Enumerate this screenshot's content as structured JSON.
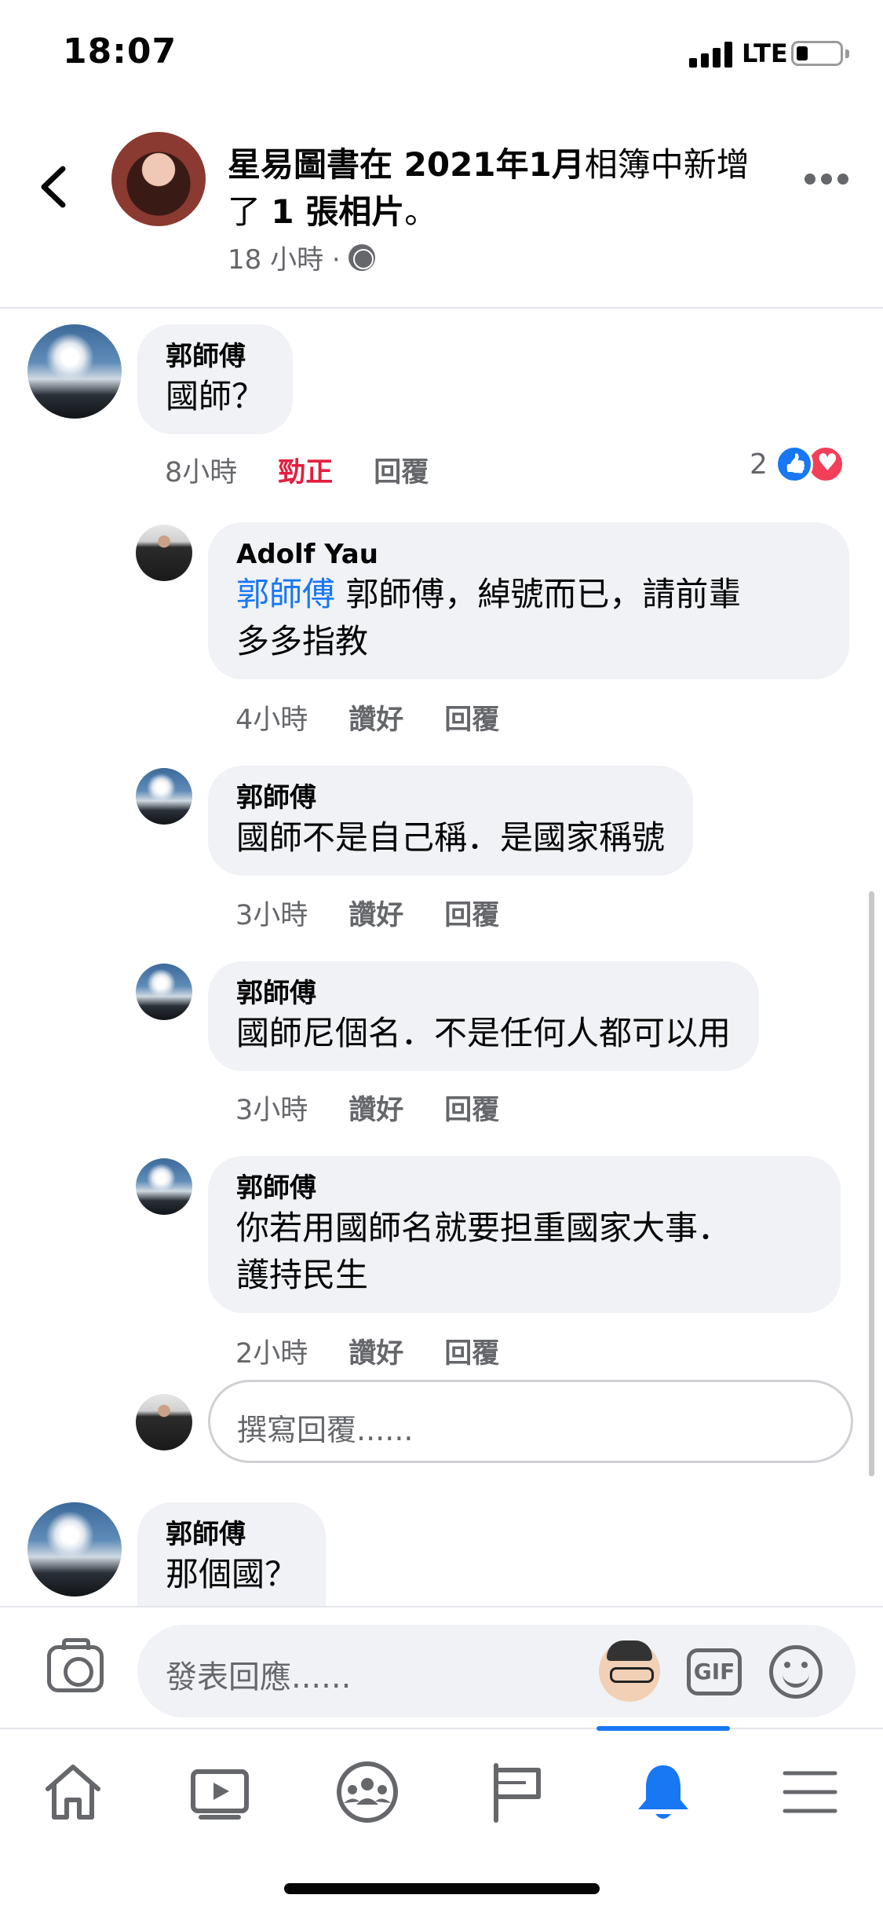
{
  "status_bar": {
    "time": "18:07",
    "network": "LTE"
  },
  "post_header": {
    "title_prefix": "星易圖書在 ",
    "title_bold_date": "2021年1月",
    "title_mid": "相簿中新增了 ",
    "title_bold_count": "1 張相片",
    "title_suffix": "。",
    "time": "18 小時 ·"
  },
  "comments": [
    {
      "name": "郭師傅",
      "text": "國師？",
      "time": "8小時",
      "react_label": "勁正",
      "reply_label": "回覆",
      "reaction_count": "2"
    }
  ],
  "replies": [
    {
      "name": "Adolf Yau",
      "mention": "郭師傅",
      "text": " 郭師傅，綽號而已，請前輩\n多多指教",
      "time": "4小時",
      "like_label": "讚好",
      "reply_label": "回覆"
    },
    {
      "name": "郭師傅",
      "text": "國師不是自己稱．是國家稱號",
      "time": "3小時",
      "like_label": "讚好",
      "reply_label": "回覆"
    },
    {
      "name": "郭師傅",
      "text": "國師尼個名．不是任何人都可以用",
      "time": "3小時",
      "like_label": "讚好",
      "reply_label": "回覆"
    },
    {
      "name": "郭師傅",
      "text": "你若用國師名就要担重國家大事．\n護持民生",
      "time": "2小時",
      "like_label": "讚好",
      "reply_label": "回覆"
    }
  ],
  "reply_input": {
    "placeholder": "撰寫回覆......"
  },
  "next_comment": {
    "name": "郭師傅",
    "text": "那個國？"
  },
  "compose": {
    "placeholder": "發表回應......",
    "gif_label": "GIF"
  },
  "tabs": [
    {
      "icon": "home-icon"
    },
    {
      "icon": "video-icon"
    },
    {
      "icon": "groups-icon"
    },
    {
      "icon": "pages-flag-icon"
    },
    {
      "icon": "notifications-bell-icon",
      "active": true
    },
    {
      "icon": "menu-icon"
    }
  ],
  "colors": {
    "accent": "#1877f2",
    "bubble": "#f0f2f5",
    "secondary_text": "#65676b",
    "react_red": "#e41e3f"
  }
}
